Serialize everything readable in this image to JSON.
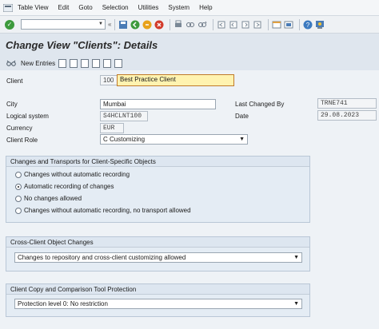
{
  "menu": [
    "Table View",
    "Edit",
    "Goto",
    "Selection",
    "Utilities",
    "System",
    "Help"
  ],
  "page_title": "Change View \"Clients\": Details",
  "app_toolbar": {
    "new_entries": "New Entries"
  },
  "fields": {
    "client_label": "Client",
    "client_number": "100",
    "client_name": "Best Practice Client",
    "city_label": "City",
    "city_value": "Mumbai",
    "logical_system_label": "Logical system",
    "logical_system_value": "S4HCLNT100",
    "currency_label": "Currency",
    "currency_value": "EUR",
    "client_role_label": "Client Role",
    "client_role_value": "C Customizing",
    "last_changed_by_label": "Last Changed By",
    "last_changed_by_value": "TRNE741",
    "date_label": "Date",
    "date_value": "29.08.2023"
  },
  "group_changes": {
    "title": "Changes and Transports for Client-Specific Objects",
    "options": [
      "Changes without automatic recording",
      "Automatic recording of changes",
      "No changes allowed",
      "Changes without automatic recording, no transport allowed"
    ],
    "selected_index": 1
  },
  "group_cross_client": {
    "title": "Cross-Client Object Changes",
    "value": "Changes to repository and cross-client customizing allowed"
  },
  "group_copy": {
    "title": "Client Copy and Comparison Tool Protection",
    "value": "Protection level 0: No restriction"
  }
}
